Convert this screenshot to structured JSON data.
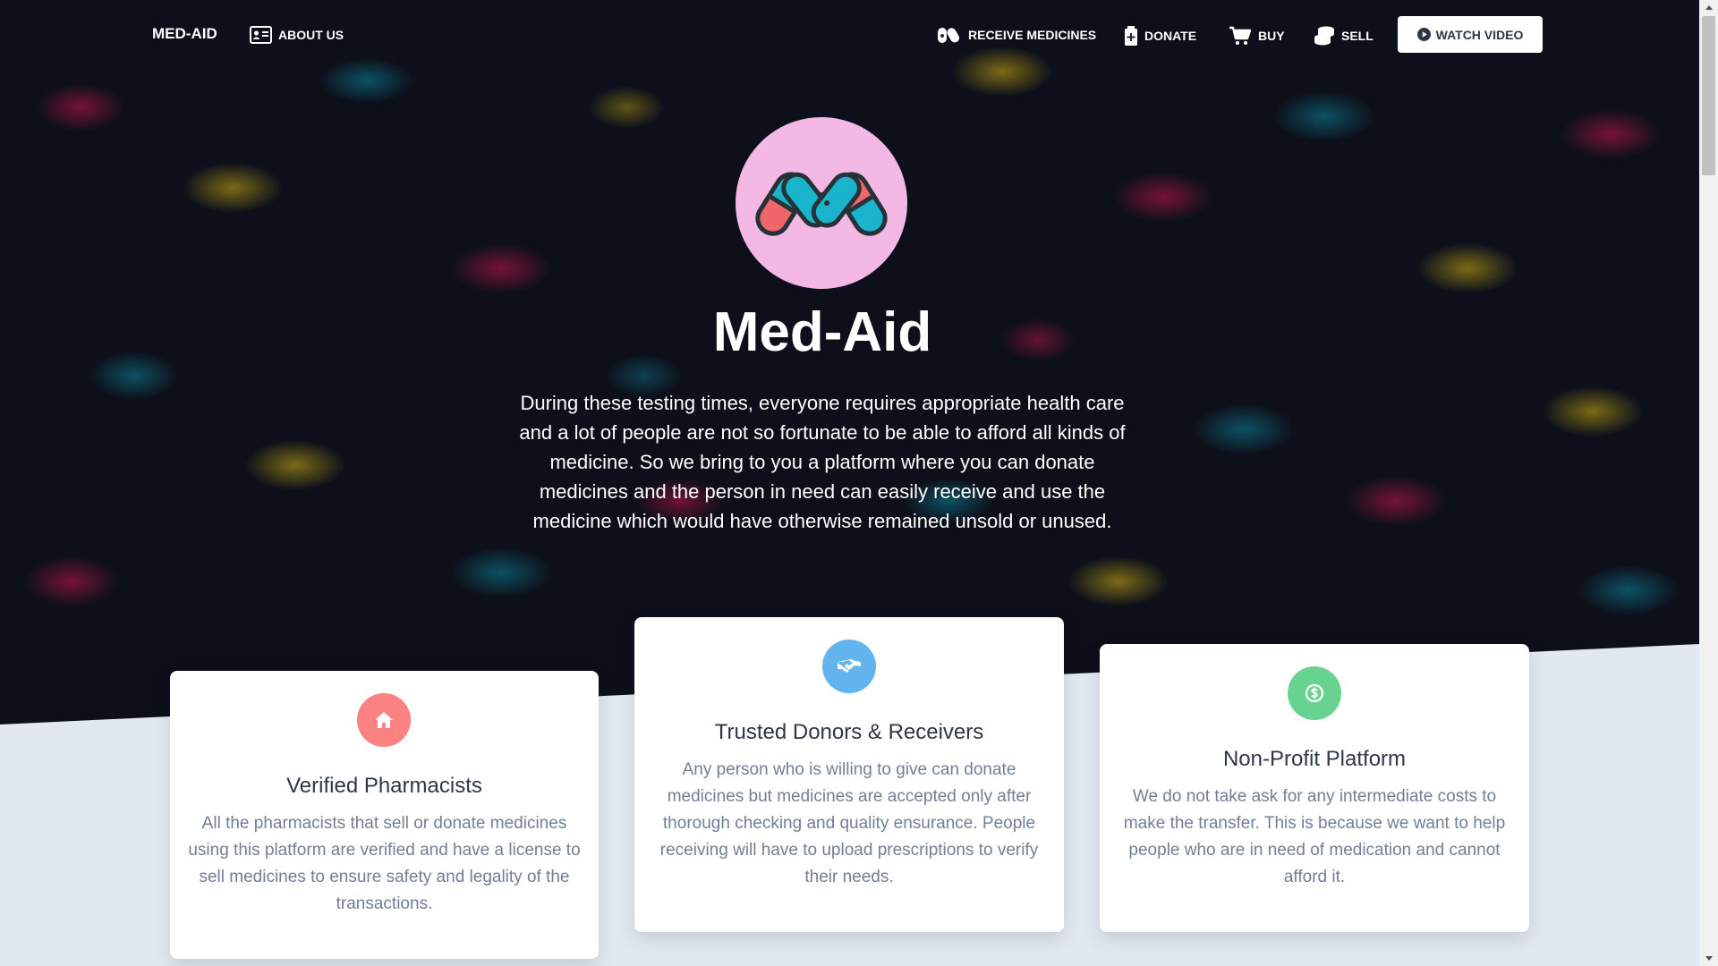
{
  "nav": {
    "brand": "MED-AID",
    "about": "ABOUT US",
    "receive": "RECEIVE MEDICINES",
    "donate": "DONATE",
    "buy": "BUY",
    "sell": "SELL",
    "watch_video": "WATCH VIDEO"
  },
  "hero": {
    "title": "Med-Aid",
    "description": "During these testing times, everyone requires appropriate health care and a lot of people are not so fortunate to be able to afford all kinds of medicine. So we bring to you a platform where you can donate medicines and the person in need can easily receive and use the medicine which would have otherwise remained unsold or unused."
  },
  "cards": [
    {
      "title": "Verified Pharmacists",
      "text": "All the pharmacists that sell or donate medicines using this platform are verified and have a license to sell medicines to ensure safety and legality of the transactions.",
      "icon": "home-icon",
      "color": "#fc8181"
    },
    {
      "title": "Trusted Donors & Receivers",
      "text": "Any person who is willing to give can donate medicines but medicines are accepted only after thorough checking and quality ensurance. People receiving will have to upload prescriptions to verify their needs.",
      "icon": "handshake-icon",
      "color": "#63b3ed"
    },
    {
      "title": "Non-Profit Platform",
      "text": "We do not take ask for any intermediate costs to make the transfer. This is because we want to help people who are in need of medication and cannot afford it.",
      "icon": "dollar-icon",
      "color": "#68d391"
    }
  ],
  "colors": {
    "logo_bg": "#f4b8e4",
    "logo_red": "#f0656a",
    "logo_teal": "#1ab4cc",
    "logo_outline": "#263238",
    "section_bg": "#e2e8f0"
  }
}
